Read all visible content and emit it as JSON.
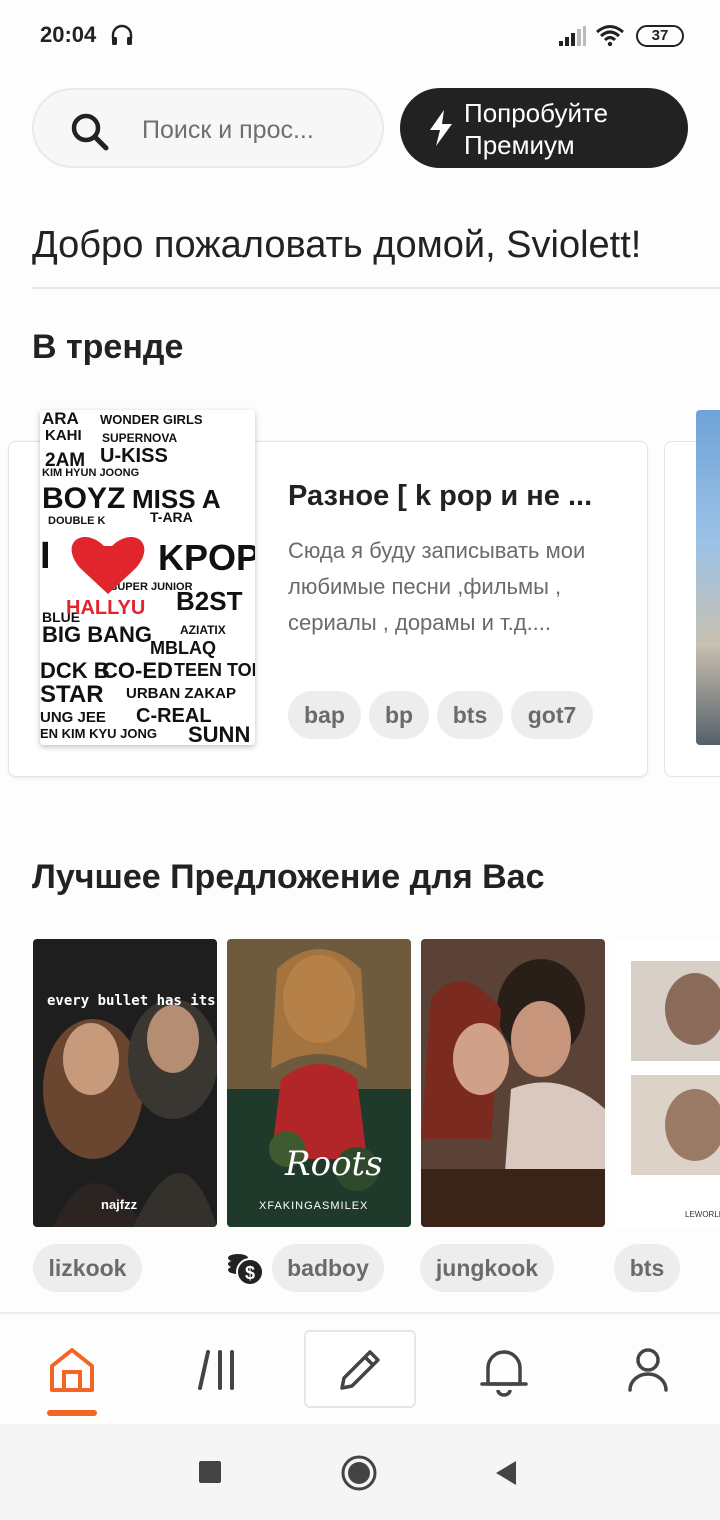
{
  "status_bar": {
    "time": "20:04",
    "battery": "37"
  },
  "search": {
    "placeholder": "Поиск и прос..."
  },
  "premium": {
    "label": "Попробуйте Премиум"
  },
  "welcome": {
    "text": "Добро пожаловать домой, Sviolett!"
  },
  "trending": {
    "title": "В тренде",
    "story": {
      "title": "Разное [ k pop и не ...",
      "description": "Сюда я буду записывать мои любимые песни ,фильмы , сериалы , дорамы и т.д....",
      "tags": [
        "bap",
        "bp",
        "bts",
        "got7"
      ]
    }
  },
  "recommended": {
    "title": "Лучшее Предложение для Вас",
    "items": [
      {
        "tag": "lizkook",
        "cover_text": "every bullet has its billet",
        "author": "najfzz"
      },
      {
        "tag": "badboy",
        "cover_script": "Roots",
        "author": "XFAKINGASMILEX"
      },
      {
        "tag": "jungkook"
      },
      {
        "tag": "bts",
        "author": "LEWORLDOFJK"
      }
    ]
  },
  "nav": {
    "items": [
      "home-icon",
      "library-icon",
      "pencil-icon",
      "bell-icon",
      "profile-icon"
    ],
    "active_color": "#f26522"
  },
  "colors": {
    "accent": "#f26522",
    "premium_bg": "#222222"
  }
}
